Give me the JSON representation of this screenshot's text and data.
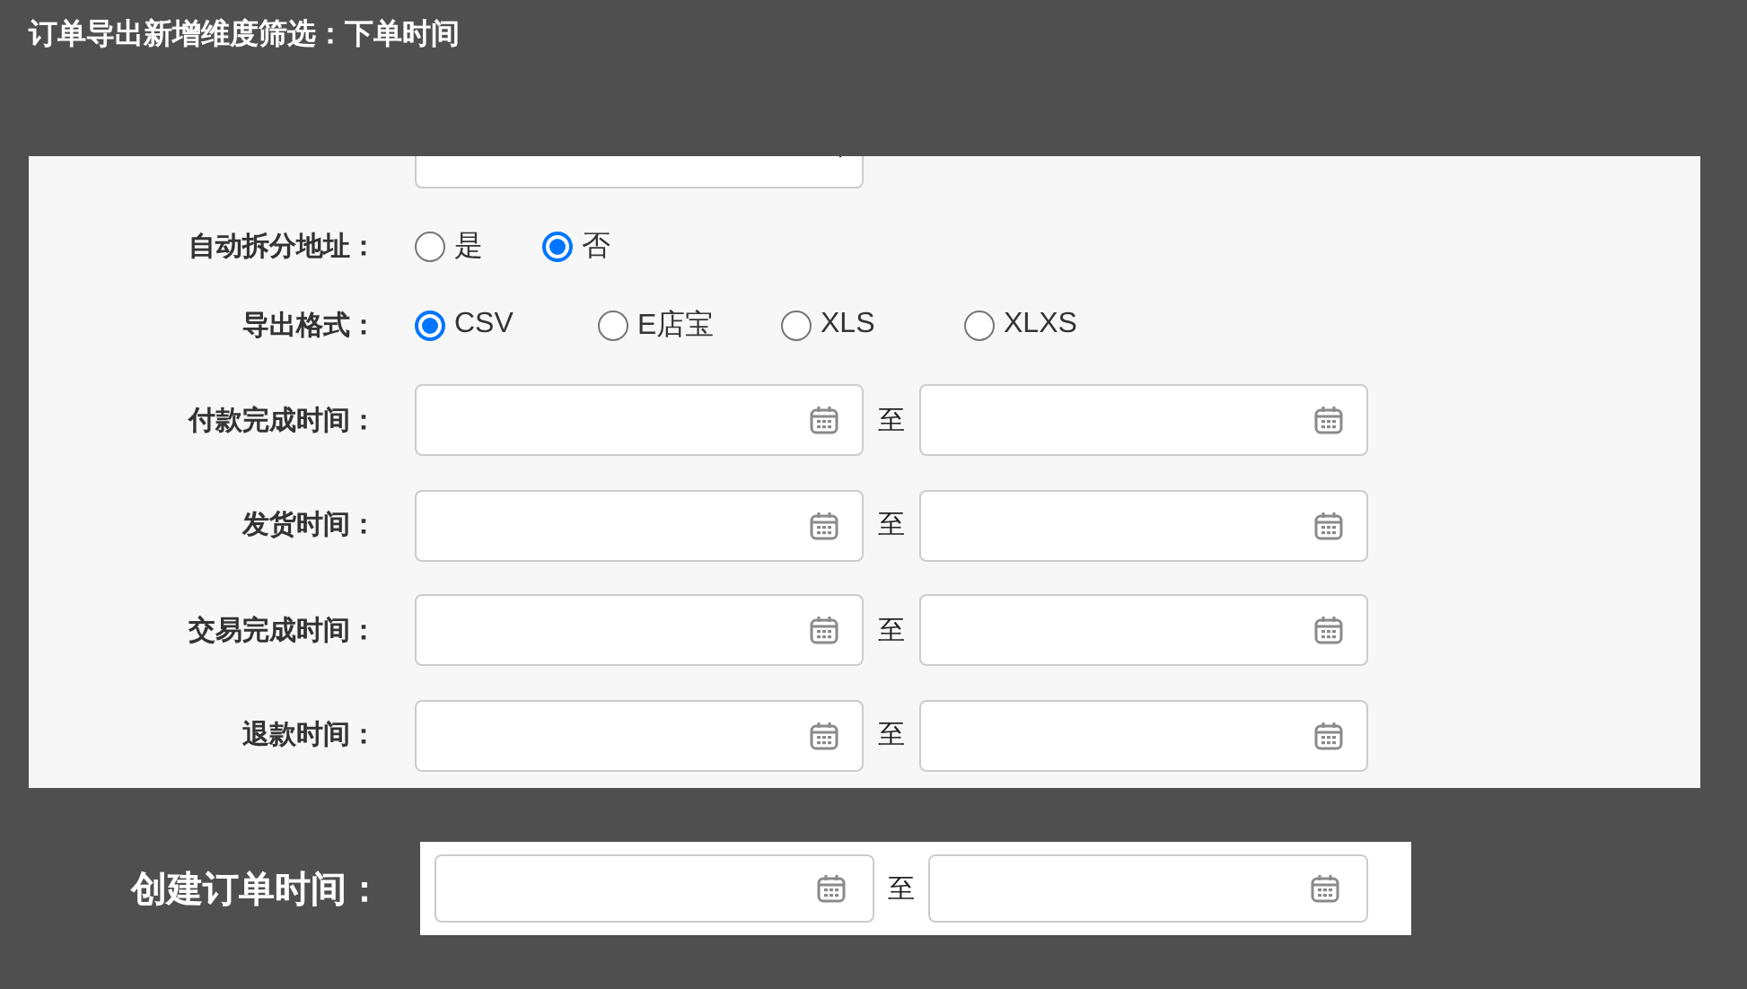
{
  "title": "订单导出新增维度筛选：下单时间",
  "radio_groups": [
    {
      "label": "自动拆分地址：",
      "options": [
        {
          "label": "是",
          "selected": false
        },
        {
          "label": "否",
          "selected": true
        }
      ]
    },
    {
      "label": "导出格式：",
      "options": [
        {
          "label": "CSV",
          "selected": true
        },
        {
          "label": "E店宝",
          "selected": false
        },
        {
          "label": "XLS",
          "selected": false
        },
        {
          "label": "XLXS",
          "selected": false
        }
      ]
    }
  ],
  "date_ranges": [
    {
      "label": "付款完成时间：",
      "separator": "至"
    },
    {
      "label": "发货时间：",
      "separator": "至"
    },
    {
      "label": "交易完成时间：",
      "separator": "至"
    },
    {
      "label": "退款时间：",
      "separator": "至"
    }
  ],
  "created_time": {
    "label": "创建订单时间：",
    "separator": "至"
  }
}
